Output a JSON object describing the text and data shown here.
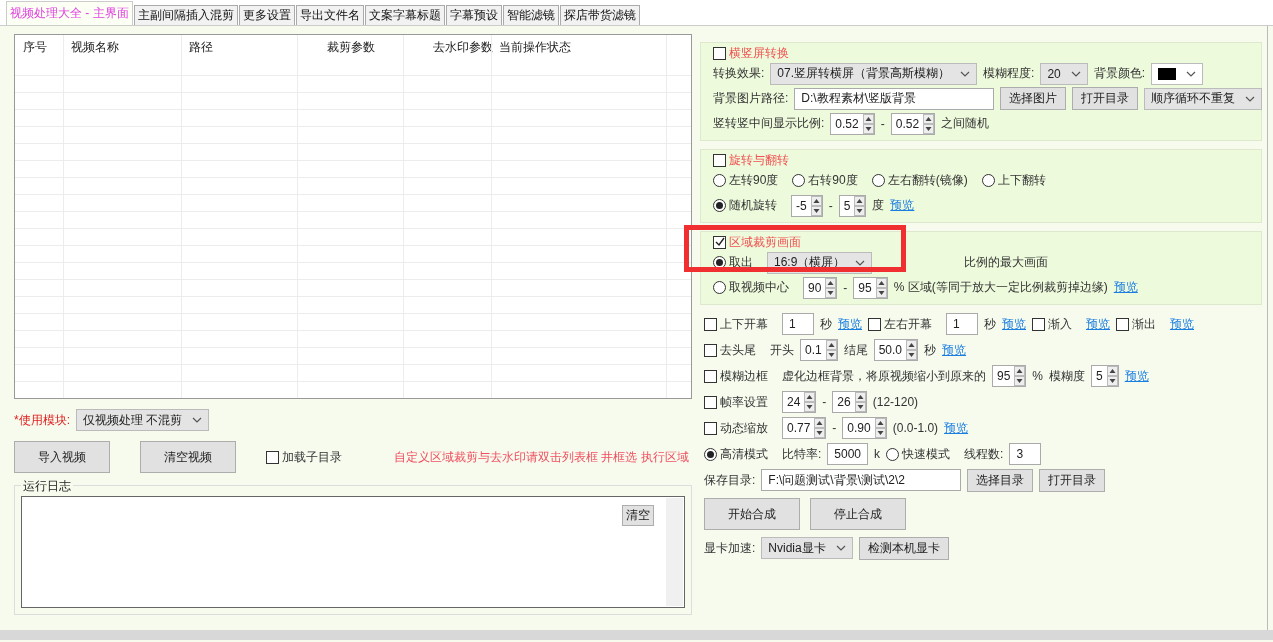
{
  "tabs": [
    {
      "label": "视频处理大全 - 主界面",
      "selected": true
    },
    {
      "label": "主副间隔插入混剪",
      "selected": false
    },
    {
      "label": "更多设置",
      "selected": false
    },
    {
      "label": "导出文件名",
      "selected": false
    },
    {
      "label": "文案字幕标题",
      "selected": false
    },
    {
      "label": "字幕预设",
      "selected": false
    },
    {
      "label": "智能滤镜",
      "selected": false
    },
    {
      "label": "探店带货滤镜",
      "selected": false
    }
  ],
  "file_table": {
    "columns": [
      "序号",
      "视频名称",
      "路径",
      "裁剪参数",
      "去水印参数",
      "当前操作状态"
    ]
  },
  "left_controls": [
    {
      "kind": "required",
      "text": "*使用模块:"
    },
    {
      "kind": "select",
      "value": "仅视频处理 不混剪"
    }
  ],
  "left_buttons": [
    {
      "kind": "bigbutton",
      "text": "导入视频"
    },
    {
      "kind": "bigbutton",
      "text": "清空视频"
    },
    {
      "kind": "check",
      "text": "加载子目录",
      "checked": false
    },
    {
      "kind": "hint",
      "text": "自定义区域裁剪与去水印请双击列表框 井框选 执行区域"
    }
  ],
  "log": {
    "title": "运行日志",
    "clear_button": "清空"
  },
  "sections": [
    {
      "title": "横竖屏转换",
      "checked": false,
      "highlighted": false,
      "lines": [
        {
          "controls": [
            {
              "kind": "label",
              "text": "转换效果:"
            },
            {
              "kind": "select",
              "value": "07.竖屏转横屏（背景高斯模糊）"
            },
            {
              "kind": "label",
              "text": "模糊程度:"
            },
            {
              "kind": "select",
              "value": "20"
            },
            {
              "kind": "label",
              "text": "背景颜色:"
            },
            {
              "kind": "color",
              "color": "#000000"
            }
          ]
        },
        {
          "controls": [
            {
              "kind": "label",
              "text": "背景图片路径:"
            },
            {
              "kind": "field",
              "value": "D:\\教程素材\\竖版背景"
            },
            {
              "kind": "button",
              "text": "选择图片"
            },
            {
              "kind": "button",
              "text": "打开目录"
            },
            {
              "kind": "select",
              "value": "顺序循环不重复"
            }
          ]
        },
        {
          "controls": [
            {
              "kind": "label",
              "text": "竖转竖中间显示比例:"
            },
            {
              "kind": "spin",
              "value": "0.52"
            },
            {
              "kind": "label",
              "text": "-"
            },
            {
              "kind": "spin",
              "value": "0.52"
            },
            {
              "kind": "label",
              "text": "之间随机"
            }
          ]
        }
      ]
    },
    {
      "title": "旋转与翻转",
      "checked": false,
      "highlighted": false,
      "lines": [
        {
          "controls": [
            {
              "kind": "radio",
              "text": "左转90度",
              "selected": false
            },
            {
              "kind": "radio",
              "text": "右转90度",
              "selected": false
            },
            {
              "kind": "radio",
              "text": "左右翻转(镜像)",
              "selected": false
            },
            {
              "kind": "radio",
              "text": "上下翻转",
              "selected": false
            }
          ]
        },
        {
          "controls": [
            {
              "kind": "radio",
              "text": "随机旋转",
              "selected": true
            },
            {
              "kind": "spin",
              "value": "-5"
            },
            {
              "kind": "label",
              "text": "-"
            },
            {
              "kind": "spin",
              "value": "5"
            },
            {
              "kind": "label",
              "text": "度"
            },
            {
              "kind": "link",
              "text": "预览"
            }
          ]
        }
      ]
    },
    {
      "title": "区域裁剪画面",
      "checked": true,
      "highlighted": true,
      "lines": [
        {
          "controls": [
            {
              "kind": "radio",
              "text": "取出",
              "selected": true
            },
            {
              "kind": "select",
              "value": "16:9（横屏）"
            },
            {
              "kind": "note",
              "text": "比例的最大画面"
            }
          ]
        },
        {
          "controls": [
            {
              "kind": "radio",
              "text": "取视频中心",
              "selected": false
            },
            {
              "kind": "spin",
              "value": "90"
            },
            {
              "kind": "label",
              "text": "-"
            },
            {
              "kind": "spin",
              "value": "95"
            },
            {
              "kind": "label",
              "text": "% 区域(等同于放大一定比例裁剪掉边缘)"
            },
            {
              "kind": "link",
              "text": "预览"
            }
          ]
        }
      ]
    }
  ],
  "option_lines": [
    {
      "controls": [
        {
          "kind": "check",
          "text": "上下开幕",
          "checked": false
        },
        {
          "kind": "field",
          "value": "1"
        },
        {
          "kind": "label",
          "text": "秒"
        },
        {
          "kind": "link",
          "text": "预览"
        },
        {
          "kind": "check",
          "text": "左右开幕",
          "checked": false
        },
        {
          "kind": "field",
          "value": "1"
        },
        {
          "kind": "label",
          "text": "秒"
        },
        {
          "kind": "link",
          "text": "预览"
        },
        {
          "kind": "check",
          "text": "渐入",
          "checked": false
        },
        {
          "kind": "link",
          "text": "预览"
        },
        {
          "kind": "check",
          "text": "渐出",
          "checked": false
        },
        {
          "kind": "link",
          "text": "预览"
        }
      ]
    },
    {
      "controls": [
        {
          "kind": "check",
          "text": "去头尾",
          "checked": false
        },
        {
          "kind": "label",
          "text": "开头"
        },
        {
          "kind": "spin",
          "value": "0.1"
        },
        {
          "kind": "label",
          "text": "结尾"
        },
        {
          "kind": "spin",
          "value": "50.0"
        },
        {
          "kind": "label",
          "text": "秒"
        },
        {
          "kind": "link",
          "text": "预览"
        }
      ]
    },
    {
      "controls": [
        {
          "kind": "check",
          "text": "模糊边框",
          "checked": false
        },
        {
          "kind": "label",
          "text": "虚化边框背景，将原视频缩小到原来的"
        },
        {
          "kind": "spin",
          "value": "95"
        },
        {
          "kind": "label",
          "text": "%"
        },
        {
          "kind": "label",
          "text": "模糊度"
        },
        {
          "kind": "spin",
          "value": "5"
        },
        {
          "kind": "link",
          "text": "预览"
        }
      ]
    },
    {
      "controls": [
        {
          "kind": "check",
          "text": "帧率设置",
          "checked": false
        },
        {
          "kind": "spin",
          "value": "24"
        },
        {
          "kind": "label",
          "text": "-"
        },
        {
          "kind": "spin",
          "value": "26"
        },
        {
          "kind": "label",
          "text": "(12-120)"
        }
      ]
    },
    {
      "controls": [
        {
          "kind": "check",
          "text": "动态缩放",
          "checked": false
        },
        {
          "kind": "spin",
          "value": "0.77"
        },
        {
          "kind": "label",
          "text": "-"
        },
        {
          "kind": "spin",
          "value": "0.90"
        },
        {
          "kind": "label",
          "text": "(0.0-1.0)"
        },
        {
          "kind": "link",
          "text": "预览"
        }
      ]
    },
    {
      "controls": [
        {
          "kind": "radio",
          "text": "高清模式",
          "selected": true
        },
        {
          "kind": "label",
          "text": "比特率:"
        },
        {
          "kind": "field",
          "value": "5000"
        },
        {
          "kind": "label",
          "text": "k"
        },
        {
          "kind": "radio",
          "text": "快速模式",
          "selected": false
        },
        {
          "kind": "label",
          "text": "线程数:"
        },
        {
          "kind": "field",
          "value": "3"
        }
      ]
    },
    {
      "controls": [
        {
          "kind": "label",
          "text": "保存目录:"
        },
        {
          "kind": "field",
          "value": "F:\\问题测试\\背景\\测试\\2\\2"
        },
        {
          "kind": "button",
          "text": "选择目录"
        },
        {
          "kind": "button",
          "text": "打开目录"
        }
      ]
    },
    {
      "controls": [
        {
          "kind": "bigbutton",
          "text": "开始合成"
        },
        {
          "kind": "bigbutton",
          "text": "停止合成"
        }
      ]
    },
    {
      "controls": [
        {
          "kind": "label",
          "text": "显卡加速:"
        },
        {
          "kind": "select",
          "value": "Nvidia显卡"
        },
        {
          "kind": "button",
          "text": "检测本机显卡"
        }
      ]
    }
  ]
}
